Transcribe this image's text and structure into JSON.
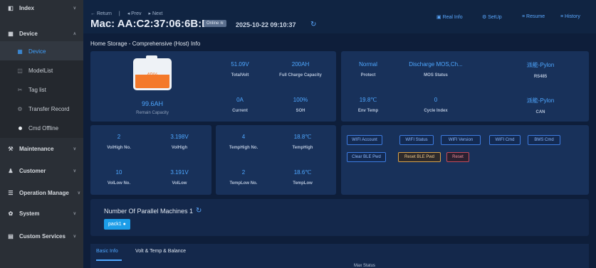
{
  "sidebar": {
    "items": [
      {
        "name": "index",
        "icon": "dashboard-icon",
        "label": "Index"
      },
      {
        "name": "device",
        "icon": "grid-icon",
        "label": "Device"
      },
      {
        "name": "device-sub",
        "icon": "grid-icon",
        "label": "Device"
      },
      {
        "name": "modellist",
        "icon": "chip-icon",
        "label": "ModelList"
      },
      {
        "name": "taglist",
        "icon": "tag-icon",
        "label": "Tag list"
      },
      {
        "name": "transfer-record",
        "icon": "transfer-icon",
        "label": "Transfer Record"
      },
      {
        "name": "cmd-offline",
        "icon": "dot-icon",
        "label": "Cmd Offline"
      },
      {
        "name": "maintenance",
        "icon": "wrench-icon",
        "label": "Maintenance"
      },
      {
        "name": "customer",
        "icon": "users-icon",
        "label": "Customer"
      },
      {
        "name": "operation-manage",
        "icon": "list-icon",
        "label": "Operation Manage"
      },
      {
        "name": "system",
        "icon": "gear-icon",
        "label": "System"
      },
      {
        "name": "custom-services",
        "icon": "service-icon",
        "label": "Custom Services"
      }
    ]
  },
  "header": {
    "return_label": "← Return",
    "separator": "|",
    "prev_label": "◂ Prev",
    "next_label": "▸ Next",
    "mac": "Mac: AA:C2:37:06:6B:B6",
    "online": "Online",
    "timestamp": "2025-10-22 09:10:37",
    "tabs": [
      "Real Info",
      "SetUp",
      "Resume",
      "History"
    ]
  },
  "section_title": "Home Storage - Comprehensive (Host) Info",
  "battery": {
    "percent_text": "49%",
    "percent": 0.49,
    "capacity": "99.6AH",
    "capacity_label": "Remain Capacity"
  },
  "stats": {
    "total_volt": {
      "value": "51.09V",
      "label": "TotalVolt"
    },
    "full_charge": {
      "value": "200AH",
      "label": "Full Charge Capacity"
    },
    "current": {
      "value": "0A",
      "label": "Current"
    },
    "soh": {
      "value": "100%",
      "label": "SOH"
    },
    "protect": {
      "value": "Normal",
      "label": "Protect"
    },
    "mos_status": {
      "value": "Discharge MOS,Ch...",
      "label": "MOS Status"
    },
    "env_temp": {
      "value": "19.8℃",
      "label": "Env Temp"
    },
    "cycle_index": {
      "value": "0",
      "label": "Cycle Index"
    },
    "rs485": {
      "value": "派能-Pylon",
      "label": "RS485"
    },
    "can": {
      "value": "派能-Pylon",
      "label": "CAN"
    },
    "volt_high_no": {
      "value": "2",
      "label": "VolHigh No."
    },
    "volt_high": {
      "value": "3.198V",
      "label": "VolHigh"
    },
    "volt_low_no": {
      "value": "10",
      "label": "VolLow No."
    },
    "volt_low": {
      "value": "3.191V",
      "label": "VolLow"
    },
    "temp_high_no": {
      "value": "4",
      "label": "TempHigh No."
    },
    "temp_high": {
      "value": "18.8℃",
      "label": "TempHigh"
    },
    "temp_low_no": {
      "value": "2",
      "label": "TempLow No."
    },
    "temp_low": {
      "value": "18.6℃",
      "label": "TempLow"
    }
  },
  "buttons": [
    "WIFI Account",
    "WIFI Status",
    "WIFI Version",
    "WIFI Cmd",
    "BMS Cmd",
    "Clear BLE Pwd",
    "Reset BLE Pwd",
    "Reset"
  ],
  "parallel": {
    "title": "Number Of Parallel Machines 1",
    "pack": "pack1"
  },
  "bottom_tabs": [
    "Basic Info",
    "Volt & Temp & Balance"
  ],
  "max_status": "Max Status"
}
